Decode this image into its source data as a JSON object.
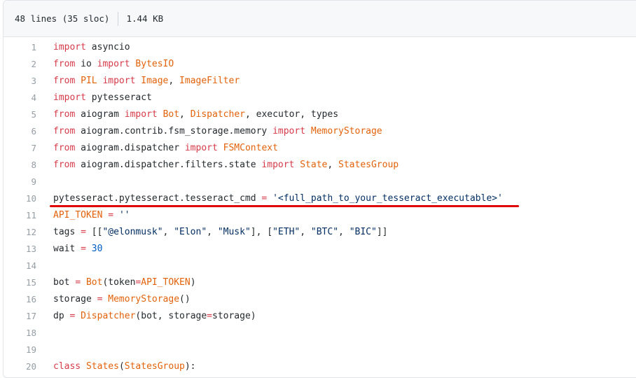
{
  "file_info": {
    "lines": "48 lines (35 sloc)",
    "size": "1.44 KB"
  },
  "code": {
    "lines": [
      {
        "num": "1",
        "tokens": [
          {
            "t": "import",
            "c": "kw"
          },
          {
            "t": " asyncio",
            "c": ""
          }
        ]
      },
      {
        "num": "2",
        "tokens": [
          {
            "t": "from",
            "c": "kw"
          },
          {
            "t": " io ",
            "c": ""
          },
          {
            "t": "import",
            "c": "kw"
          },
          {
            "t": " ",
            "c": ""
          },
          {
            "t": "BytesIO",
            "c": "ent"
          }
        ]
      },
      {
        "num": "3",
        "tokens": [
          {
            "t": "from",
            "c": "kw"
          },
          {
            "t": " ",
            "c": ""
          },
          {
            "t": "PIL",
            "c": "ent"
          },
          {
            "t": " ",
            "c": ""
          },
          {
            "t": "import",
            "c": "kw"
          },
          {
            "t": " ",
            "c": ""
          },
          {
            "t": "Image",
            "c": "ent"
          },
          {
            "t": ", ",
            "c": ""
          },
          {
            "t": "ImageFilter",
            "c": "ent"
          }
        ]
      },
      {
        "num": "4",
        "tokens": [
          {
            "t": "import",
            "c": "kw"
          },
          {
            "t": " pytesseract",
            "c": ""
          }
        ]
      },
      {
        "num": "5",
        "tokens": [
          {
            "t": "from",
            "c": "kw"
          },
          {
            "t": " aiogram ",
            "c": ""
          },
          {
            "t": "import",
            "c": "kw"
          },
          {
            "t": " ",
            "c": ""
          },
          {
            "t": "Bot",
            "c": "ent"
          },
          {
            "t": ", ",
            "c": ""
          },
          {
            "t": "Dispatcher",
            "c": "ent"
          },
          {
            "t": ", executor, types",
            "c": ""
          }
        ]
      },
      {
        "num": "6",
        "tokens": [
          {
            "t": "from",
            "c": "kw"
          },
          {
            "t": " aiogram.contrib.fsm_storage.memory ",
            "c": ""
          },
          {
            "t": "import",
            "c": "kw"
          },
          {
            "t": " ",
            "c": ""
          },
          {
            "t": "MemoryStorage",
            "c": "ent"
          }
        ]
      },
      {
        "num": "7",
        "tokens": [
          {
            "t": "from",
            "c": "kw"
          },
          {
            "t": " aiogram.dispatcher ",
            "c": ""
          },
          {
            "t": "import",
            "c": "kw"
          },
          {
            "t": " ",
            "c": ""
          },
          {
            "t": "FSMContext",
            "c": "ent"
          }
        ]
      },
      {
        "num": "8",
        "tokens": [
          {
            "t": "from",
            "c": "kw"
          },
          {
            "t": " aiogram.dispatcher.filters.state ",
            "c": ""
          },
          {
            "t": "import",
            "c": "kw"
          },
          {
            "t": " ",
            "c": ""
          },
          {
            "t": "State",
            "c": "ent"
          },
          {
            "t": ", ",
            "c": ""
          },
          {
            "t": "StatesGroup",
            "c": "ent"
          }
        ]
      },
      {
        "num": "9",
        "tokens": []
      },
      {
        "num": "10",
        "tokens": [
          {
            "t": "pytesseract.pytesseract.tesseract_cmd ",
            "c": ""
          },
          {
            "t": "=",
            "c": "kw"
          },
          {
            "t": " ",
            "c": ""
          },
          {
            "t": "'<full_path_to_your_tesseract_executable>'",
            "c": "str"
          }
        ]
      },
      {
        "num": "11",
        "tokens": [
          {
            "t": "API_TOKEN",
            "c": "ent"
          },
          {
            "t": " ",
            "c": ""
          },
          {
            "t": "=",
            "c": "kw"
          },
          {
            "t": " ",
            "c": ""
          },
          {
            "t": "''",
            "c": "str"
          }
        ]
      },
      {
        "num": "12",
        "tokens": [
          {
            "t": "tags ",
            "c": ""
          },
          {
            "t": "=",
            "c": "kw"
          },
          {
            "t": " [[",
            "c": ""
          },
          {
            "t": "\"@elonmusk\"",
            "c": "str"
          },
          {
            "t": ", ",
            "c": ""
          },
          {
            "t": "\"Elon\"",
            "c": "str"
          },
          {
            "t": ", ",
            "c": ""
          },
          {
            "t": "\"Musk\"",
            "c": "str"
          },
          {
            "t": "], [",
            "c": ""
          },
          {
            "t": "\"ETH\"",
            "c": "str"
          },
          {
            "t": ", ",
            "c": ""
          },
          {
            "t": "\"BTC\"",
            "c": "str"
          },
          {
            "t": ", ",
            "c": ""
          },
          {
            "t": "\"BIC\"",
            "c": "str"
          },
          {
            "t": "]]",
            "c": ""
          }
        ]
      },
      {
        "num": "13",
        "tokens": [
          {
            "t": "wait ",
            "c": ""
          },
          {
            "t": "=",
            "c": "kw"
          },
          {
            "t": " ",
            "c": ""
          },
          {
            "t": "30",
            "c": "num"
          }
        ]
      },
      {
        "num": "14",
        "tokens": []
      },
      {
        "num": "15",
        "tokens": [
          {
            "t": "bot ",
            "c": ""
          },
          {
            "t": "=",
            "c": "kw"
          },
          {
            "t": " ",
            "c": ""
          },
          {
            "t": "Bot",
            "c": "ent"
          },
          {
            "t": "(token",
            "c": ""
          },
          {
            "t": "=",
            "c": "kw"
          },
          {
            "t": "API_TOKEN",
            "c": "ent"
          },
          {
            "t": ")",
            "c": ""
          }
        ]
      },
      {
        "num": "16",
        "tokens": [
          {
            "t": "storage ",
            "c": ""
          },
          {
            "t": "=",
            "c": "kw"
          },
          {
            "t": " ",
            "c": ""
          },
          {
            "t": "MemoryStorage",
            "c": "ent"
          },
          {
            "t": "()",
            "c": ""
          }
        ]
      },
      {
        "num": "17",
        "tokens": [
          {
            "t": "dp ",
            "c": ""
          },
          {
            "t": "=",
            "c": "kw"
          },
          {
            "t": " ",
            "c": ""
          },
          {
            "t": "Dispatcher",
            "c": "ent"
          },
          {
            "t": "(bot, storage",
            "c": ""
          },
          {
            "t": "=",
            "c": "kw"
          },
          {
            "t": "storage)",
            "c": ""
          }
        ]
      },
      {
        "num": "18",
        "tokens": []
      },
      {
        "num": "19",
        "tokens": []
      },
      {
        "num": "20",
        "tokens": [
          {
            "t": "class",
            "c": "kw"
          },
          {
            "t": " ",
            "c": ""
          },
          {
            "t": "States",
            "c": "ent"
          },
          {
            "t": "(",
            "c": ""
          },
          {
            "t": "StatesGroup",
            "c": "ent"
          },
          {
            "t": "):",
            "c": ""
          }
        ]
      }
    ]
  },
  "colors": {
    "keyword": "#d73a49",
    "entity": "#e36209",
    "string": "#032f62",
    "number": "#005cc5",
    "highlight_underline": "#e00000"
  }
}
